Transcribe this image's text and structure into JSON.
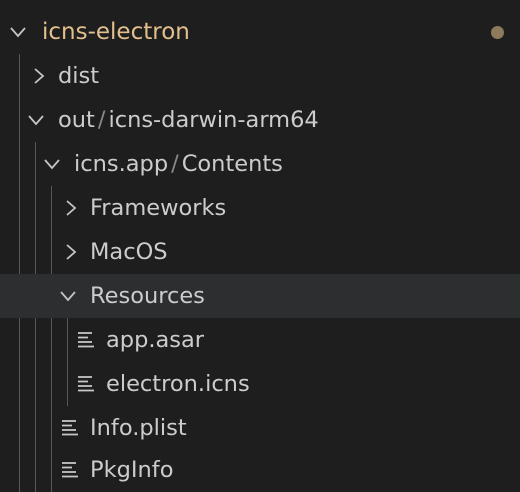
{
  "explorer": {
    "root": {
      "name": "icns-electron",
      "expanded": true,
      "has_changes": true,
      "change_dot_color": "#8c7a5b",
      "label_color": "#e2c08d"
    },
    "items": [
      {
        "name": "dist",
        "kind": "folder",
        "expanded": false
      },
      {
        "name": "out",
        "sub": "icns-darwin-arm64",
        "kind": "folder",
        "expanded": true
      },
      {
        "name": "icns.app",
        "sub": "Contents",
        "kind": "folder",
        "expanded": true
      },
      {
        "name": "Frameworks",
        "kind": "folder",
        "expanded": false
      },
      {
        "name": "MacOS",
        "kind": "folder",
        "expanded": false
      },
      {
        "name": "Resources",
        "kind": "folder",
        "expanded": true,
        "selected": true
      },
      {
        "name": "app.asar",
        "kind": "file",
        "icon": "lines-file-icon"
      },
      {
        "name": "electron.icns",
        "kind": "file",
        "icon": "lines-file-icon"
      },
      {
        "name": "Info.plist",
        "kind": "file",
        "icon": "lines-file-icon"
      },
      {
        "name": "PkgInfo",
        "kind": "file",
        "icon": "lines-file-icon"
      }
    ],
    "path_separator": "/"
  }
}
